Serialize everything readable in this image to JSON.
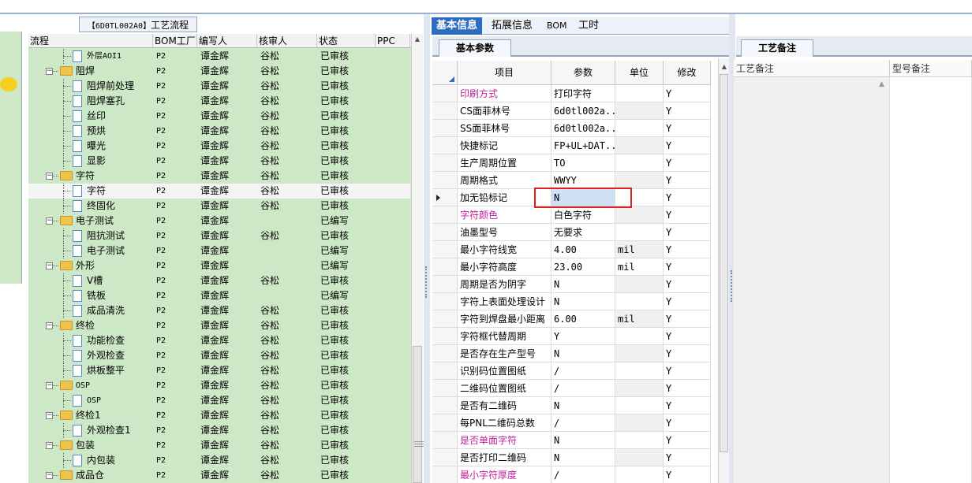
{
  "left_panel": {
    "title_code": "【6D0TL002A0】",
    "title_text": "工艺流程",
    "columns": [
      "流程",
      "BOM工厂",
      "编写人",
      "核审人",
      "状态",
      "PPC"
    ],
    "rows": [
      {
        "name": "外层AOI1",
        "factory": "P2",
        "writer": "谭金辉",
        "reviewer": "谷松",
        "status": "已审核",
        "level": 2,
        "kind": "doc",
        "mono": true
      },
      {
        "name": "阻焊",
        "factory": "P2",
        "writer": "谭金辉",
        "reviewer": "谷松",
        "status": "已审核",
        "level": 1,
        "kind": "folder"
      },
      {
        "name": "阻焊前处理",
        "factory": "P2",
        "writer": "谭金辉",
        "reviewer": "谷松",
        "status": "已审核",
        "level": 2,
        "kind": "doc"
      },
      {
        "name": "阻焊塞孔",
        "factory": "P2",
        "writer": "谭金辉",
        "reviewer": "谷松",
        "status": "已审核",
        "level": 2,
        "kind": "doc"
      },
      {
        "name": "丝印",
        "factory": "P2",
        "writer": "谭金辉",
        "reviewer": "谷松",
        "status": "已审核",
        "level": 2,
        "kind": "doc"
      },
      {
        "name": "预烘",
        "factory": "P2",
        "writer": "谭金辉",
        "reviewer": "谷松",
        "status": "已审核",
        "level": 2,
        "kind": "doc"
      },
      {
        "name": "曝光",
        "factory": "P2",
        "writer": "谭金辉",
        "reviewer": "谷松",
        "status": "已审核",
        "level": 2,
        "kind": "doc"
      },
      {
        "name": "显影",
        "factory": "P2",
        "writer": "谭金辉",
        "reviewer": "谷松",
        "status": "已审核",
        "level": 2,
        "kind": "doc"
      },
      {
        "name": "字符",
        "factory": "P2",
        "writer": "谭金辉",
        "reviewer": "谷松",
        "status": "已审核",
        "level": 1,
        "kind": "folder"
      },
      {
        "name": "字符",
        "factory": "P2",
        "writer": "谭金辉",
        "reviewer": "谷松",
        "status": "已审核",
        "level": 2,
        "kind": "doc",
        "selected": true
      },
      {
        "name": "终固化",
        "factory": "P2",
        "writer": "谭金辉",
        "reviewer": "谷松",
        "status": "已审核",
        "level": 2,
        "kind": "doc"
      },
      {
        "name": "电子测试",
        "factory": "P2",
        "writer": "谭金辉",
        "reviewer": "",
        "status": "已编写",
        "level": 1,
        "kind": "folder"
      },
      {
        "name": "阻抗测试",
        "factory": "P2",
        "writer": "谭金辉",
        "reviewer": "谷松",
        "status": "已审核",
        "level": 2,
        "kind": "doc"
      },
      {
        "name": "电子测试",
        "factory": "P2",
        "writer": "谭金辉",
        "reviewer": "",
        "status": "已编写",
        "level": 2,
        "kind": "doc"
      },
      {
        "name": "外形",
        "factory": "P2",
        "writer": "谭金辉",
        "reviewer": "",
        "status": "已编写",
        "level": 1,
        "kind": "folder"
      },
      {
        "name": "V槽",
        "factory": "P2",
        "writer": "谭金辉",
        "reviewer": "谷松",
        "status": "已审核",
        "level": 2,
        "kind": "doc"
      },
      {
        "name": "铣板",
        "factory": "P2",
        "writer": "谭金辉",
        "reviewer": "",
        "status": "已编写",
        "level": 2,
        "kind": "doc"
      },
      {
        "name": "成品清洗",
        "factory": "P2",
        "writer": "谭金辉",
        "reviewer": "谷松",
        "status": "已审核",
        "level": 2,
        "kind": "doc"
      },
      {
        "name": "终检",
        "factory": "P2",
        "writer": "谭金辉",
        "reviewer": "谷松",
        "status": "已审核",
        "level": 1,
        "kind": "folder"
      },
      {
        "name": "功能检查",
        "factory": "P2",
        "writer": "谭金辉",
        "reviewer": "谷松",
        "status": "已审核",
        "level": 2,
        "kind": "doc"
      },
      {
        "name": "外观检查",
        "factory": "P2",
        "writer": "谭金辉",
        "reviewer": "谷松",
        "status": "已审核",
        "level": 2,
        "kind": "doc"
      },
      {
        "name": "烘板整平",
        "factory": "P2",
        "writer": "谭金辉",
        "reviewer": "谷松",
        "status": "已审核",
        "level": 2,
        "kind": "doc"
      },
      {
        "name": "OSP",
        "factory": "P2",
        "writer": "谭金辉",
        "reviewer": "谷松",
        "status": "已审核",
        "level": 1,
        "kind": "folder",
        "mono": true
      },
      {
        "name": "OSP",
        "factory": "P2",
        "writer": "谭金辉",
        "reviewer": "谷松",
        "status": "已审核",
        "level": 2,
        "kind": "doc",
        "mono": true
      },
      {
        "name": "终检1",
        "factory": "P2",
        "writer": "谭金辉",
        "reviewer": "谷松",
        "status": "已审核",
        "level": 1,
        "kind": "folder"
      },
      {
        "name": "外观检查1",
        "factory": "P2",
        "writer": "谭金辉",
        "reviewer": "谷松",
        "status": "已审核",
        "level": 2,
        "kind": "doc"
      },
      {
        "name": "包装",
        "factory": "P2",
        "writer": "谭金辉",
        "reviewer": "谷松",
        "status": "已审核",
        "level": 1,
        "kind": "folder"
      },
      {
        "name": "内包装",
        "factory": "P2",
        "writer": "谭金辉",
        "reviewer": "谷松",
        "status": "已审核",
        "level": 2,
        "kind": "doc"
      },
      {
        "name": "成品仓",
        "factory": "P2",
        "writer": "谭金辉",
        "reviewer": "谷松",
        "status": "已审核",
        "level": 1,
        "kind": "folder"
      }
    ]
  },
  "tabs": [
    "基本信息",
    "拓展信息",
    "BOM",
    "工时"
  ],
  "sub_tab": "基本参数",
  "params_grid": {
    "columns": [
      "项目",
      "参数",
      "单位",
      "修改"
    ],
    "rows": [
      {
        "item": "印刷方式",
        "value": "打印字符",
        "unit": "",
        "edit": "Y",
        "magenta": true
      },
      {
        "item": "CS面菲林号",
        "value": "6d0tl002a...",
        "unit": "",
        "edit": "Y"
      },
      {
        "item": "SS面菲林号",
        "value": "6d0tl002a...",
        "unit": "",
        "edit": "Y"
      },
      {
        "item": "快捷标记",
        "value": "FP+UL+DAT...",
        "unit": "",
        "edit": "Y"
      },
      {
        "item": "生产周期位置",
        "value": "TO",
        "unit": "",
        "edit": "Y"
      },
      {
        "item": "周期格式",
        "value": "WWYY",
        "unit": "",
        "edit": "Y"
      },
      {
        "item": "加无铅标记",
        "value": "N",
        "unit": "",
        "edit": "Y",
        "current": true
      },
      {
        "item": "字符颜色",
        "value": "白色字符",
        "unit": "",
        "edit": "Y",
        "magenta": true
      },
      {
        "item": "油墨型号",
        "value": "无要求",
        "unit": "",
        "edit": "Y"
      },
      {
        "item": "最小字符线宽",
        "value": "4.00",
        "unit": "mil",
        "edit": "Y"
      },
      {
        "item": "最小字符高度",
        "value": "23.00",
        "unit": "mil",
        "edit": "Y"
      },
      {
        "item": "周期是否为阴字",
        "value": "N",
        "unit": "",
        "edit": "Y"
      },
      {
        "item": "字符上表面处理设计",
        "value": "N",
        "unit": "",
        "edit": "Y"
      },
      {
        "item": "字符到焊盘最小距离",
        "value": "6.00",
        "unit": "mil",
        "edit": "Y"
      },
      {
        "item": "字符框代替周期",
        "value": "Y",
        "unit": "",
        "edit": "Y"
      },
      {
        "item": "是否存在生产型号",
        "value": "N",
        "unit": "",
        "edit": "Y"
      },
      {
        "item": "识别码位置图纸",
        "value": "/",
        "unit": "",
        "edit": "Y"
      },
      {
        "item": "二维码位置图纸",
        "value": "/",
        "unit": "",
        "edit": "Y"
      },
      {
        "item": "是否有二维码",
        "value": "N",
        "unit": "",
        "edit": "Y"
      },
      {
        "item": "每PNL二维码总数",
        "value": "/",
        "unit": "",
        "edit": "Y"
      },
      {
        "item": "是否单面字符",
        "value": "N",
        "unit": "",
        "edit": "Y",
        "magenta": true
      },
      {
        "item": "是否打印二维码",
        "value": "N",
        "unit": "",
        "edit": "Y"
      },
      {
        "item": "最小字符厚度",
        "value": "/",
        "unit": "",
        "edit": "Y",
        "magenta": true
      }
    ]
  },
  "right_panel": {
    "tab": "工艺备注",
    "columns": [
      "工艺备注",
      "型号备注"
    ]
  }
}
